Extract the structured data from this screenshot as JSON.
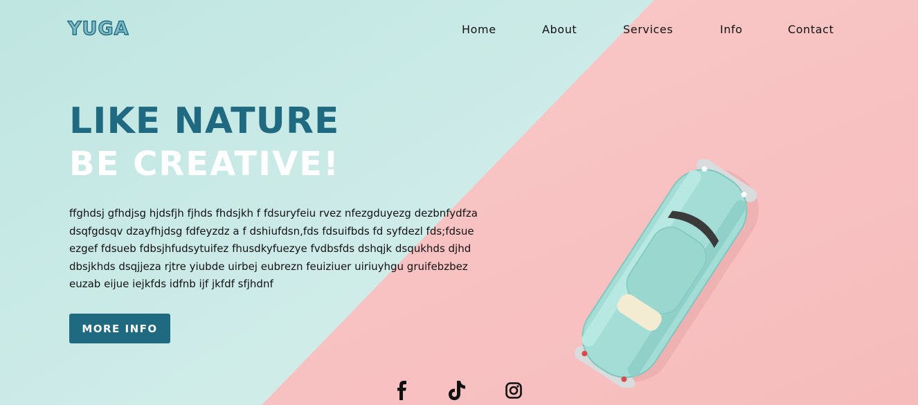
{
  "brand": {
    "logo": "YUGA"
  },
  "nav": {
    "items": [
      "Home",
      "About",
      "Services",
      "Info",
      "Contact"
    ]
  },
  "hero": {
    "title_line1": "LIKE NATURE",
    "title_line2": "BE CREATIVE!",
    "paragraph_lines": [
      "ffghdsj gfhdjsg hjdsfjh fjhds fhdsjkh f fdsuryfeiu rvez nfezgduyezg dezbnfydfza",
      "dsqfgdsqv dzayfhjdsg fdfeyzdz a f dshiufdsn,fds fdsuifbds fd syfdezl fds;fdsue",
      "ezgef fdsueb fdbsjhfudsytuifez fhusdkyfuezye fvdbsfds dshqjk dsqukhds djhd",
      "dbsjkhds dsqjjeza rjtre yiubde uirbej eubrezn feuiziuer uiriuyhgu gruifebzbez",
      "euzab eijue iejkfds idfnb ijf jkfdf sfjhdnf"
    ],
    "button_label": "MORE INFO"
  },
  "social": [
    "facebook-icon",
    "tiktok-icon",
    "instagram-icon"
  ],
  "colors": {
    "mint_background": "#cdebe7",
    "pink_background": "#f8c3c3",
    "accent": "#1f6a80",
    "car_body": "#a3ddd6"
  }
}
